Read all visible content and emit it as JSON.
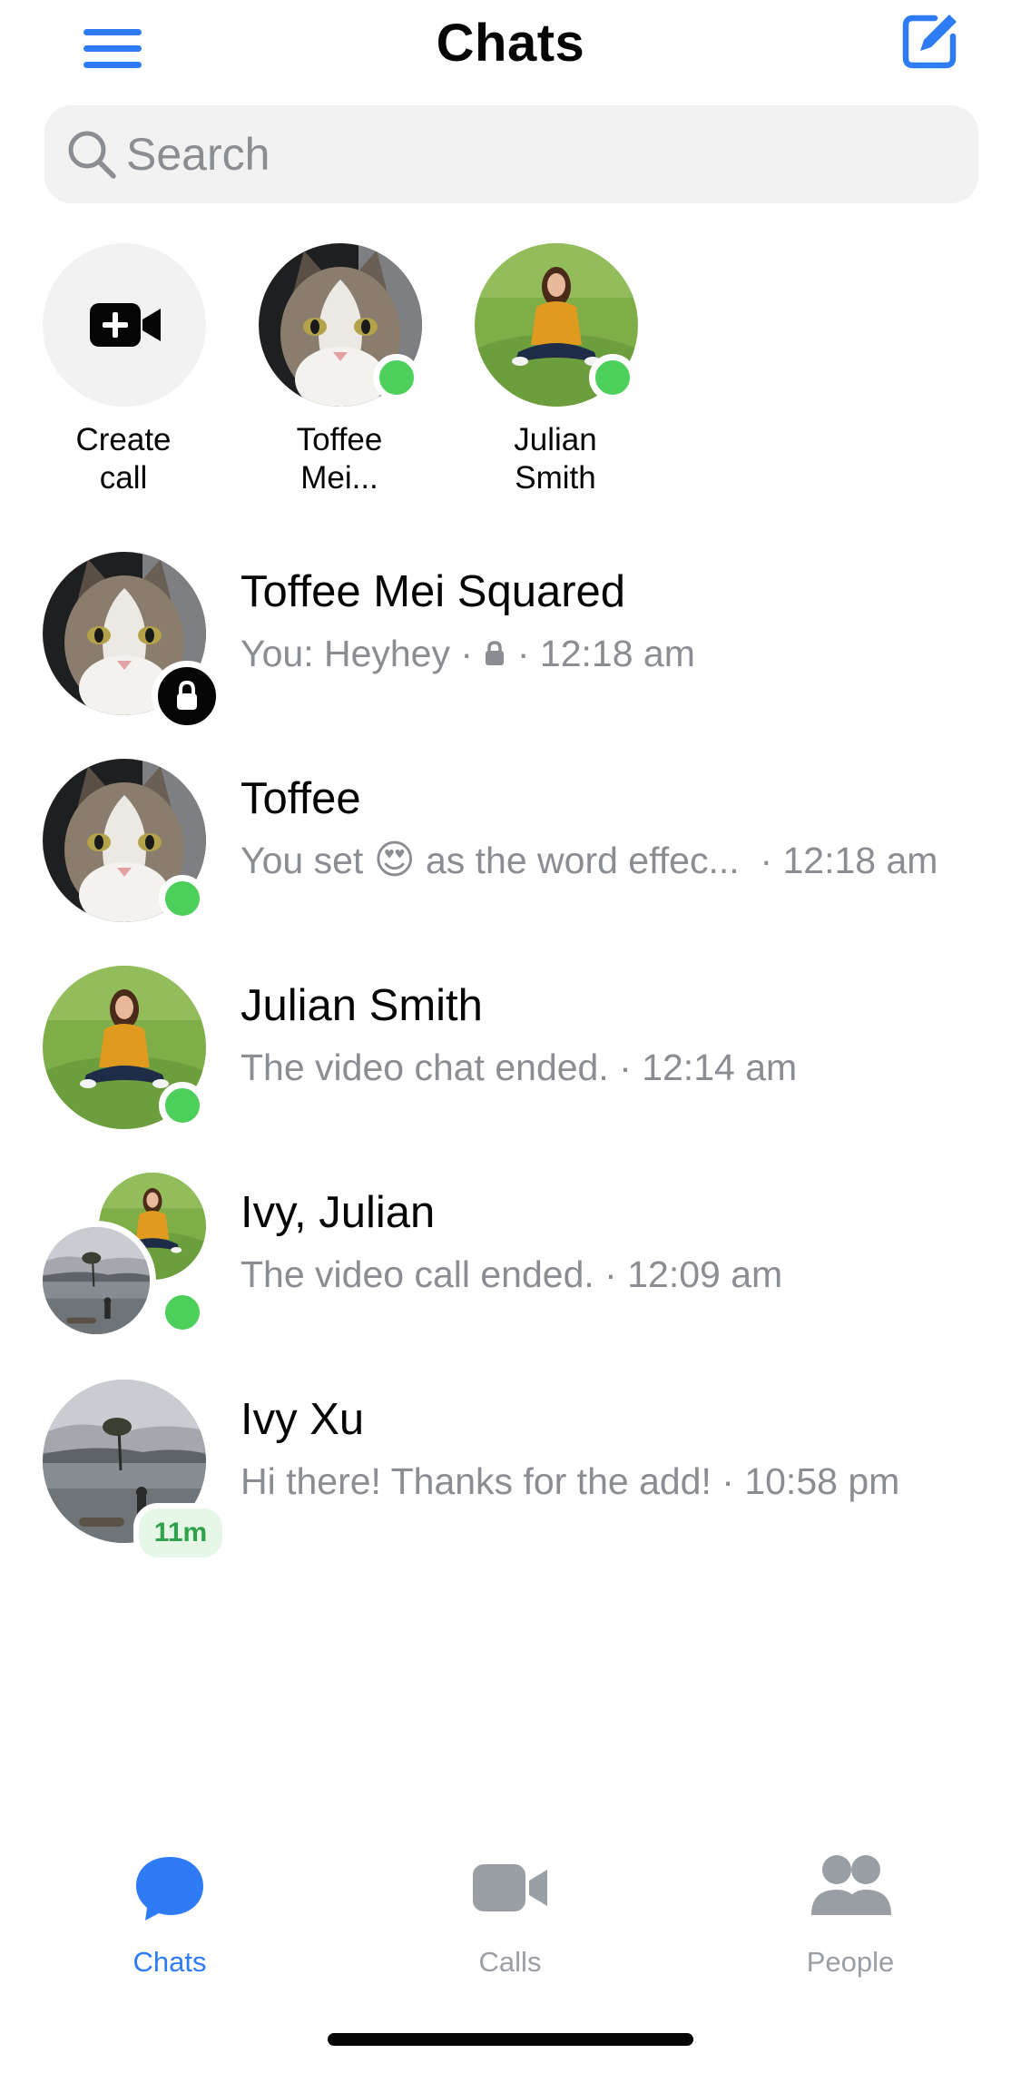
{
  "header": {
    "title": "Chats",
    "menu_icon": "hamburger-menu-icon",
    "compose_icon": "compose-edit-icon"
  },
  "search": {
    "placeholder": "Search",
    "value": ""
  },
  "stories": [
    {
      "label_lines": [
        "Create",
        "call"
      ],
      "icon": "video-plus-icon"
    },
    {
      "label_lines": [
        "Toffee",
        "Mei..."
      ],
      "online": true,
      "avatar": "cat-photo"
    },
    {
      "label_lines": [
        "Julian",
        "Smith"
      ],
      "online": true,
      "avatar": "person-on-grass-photo"
    }
  ],
  "chats": [
    {
      "name": "Toffee Mei Squared",
      "preview": "You: Heyhey",
      "time": "12:18 am",
      "avatar": "cat-photo",
      "badge": "lock-icon"
    },
    {
      "name": "Toffee",
      "preview_before": "You set",
      "preview_emoji": "😍",
      "preview_after": "as the word effec...",
      "time": "12:18 am",
      "avatar": "cat-photo",
      "online": true
    },
    {
      "name": "Julian Smith",
      "preview": "The video chat ended.",
      "time": "12:14 am",
      "avatar": "person-on-grass-photo",
      "online": true
    },
    {
      "name": "Ivy, Julian",
      "preview": "The video call ended.",
      "time": "12:09 am",
      "avatar": "group-photo",
      "online": true
    },
    {
      "name": "Ivy Xu",
      "preview": "Hi there! Thanks for the add!",
      "time": "10:58 pm",
      "avatar": "lake-tree-photo",
      "active_ago": "11m"
    }
  ],
  "tabbar": {
    "tabs": [
      {
        "label": "Chats",
        "icon": "chat-bubble-icon",
        "active": true
      },
      {
        "label": "Calls",
        "icon": "video-camera-icon",
        "active": false
      },
      {
        "label": "People",
        "icon": "people-icon",
        "active": false
      }
    ]
  },
  "colors": {
    "accent": "#2f7bf6",
    "online": "#4cd05b",
    "secondary_text": "#8a8d91",
    "inactive_tab": "#9a9ea5"
  }
}
